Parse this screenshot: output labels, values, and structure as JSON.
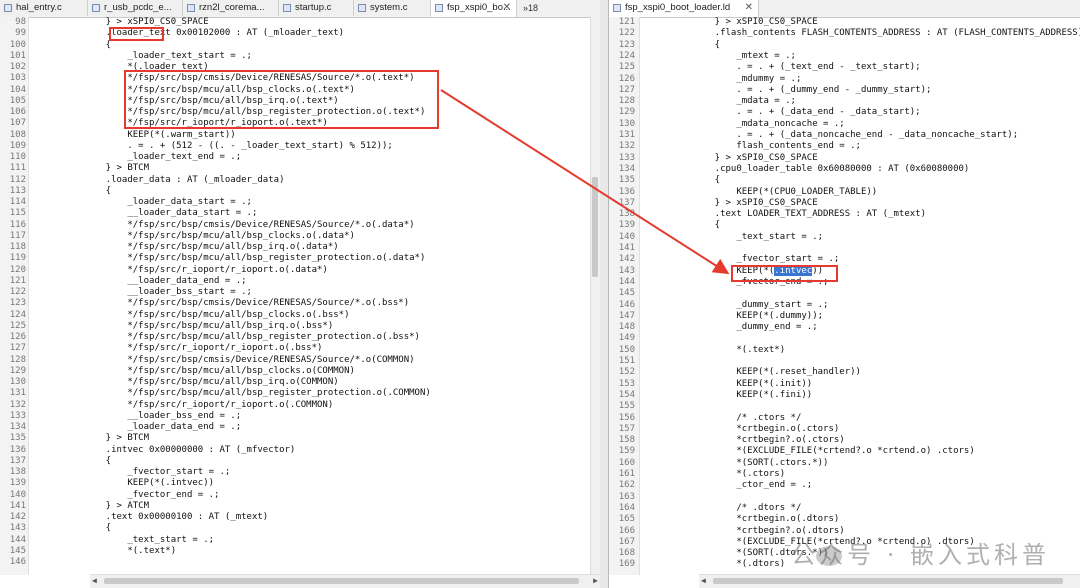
{
  "left_tabs": [
    {
      "label": "hal_entry.c",
      "active": false
    },
    {
      "label": "r_usb_pcdc_e...",
      "active": false
    },
    {
      "label": "rzn2l_corema...",
      "active": false
    },
    {
      "label": "startup.c",
      "active": false
    },
    {
      "label": "system.c",
      "active": false
    },
    {
      "label": "fsp_xspi0_bo...",
      "active": true
    }
  ],
  "left_overflow": "»18",
  "right_tab": {
    "label": "fsp_xspi0_boot_loader.ld",
    "active": true
  },
  "left_lines": [
    {
      "n": "98",
      "t": "    } > xSPI0_CS0_SPACE"
    },
    {
      "n": "99",
      "t": "    .loader_text 0x00102000 : AT (_mloader_text)"
    },
    {
      "n": "100",
      "t": "    {"
    },
    {
      "n": "101",
      "t": "        _loader_text_start = .;"
    },
    {
      "n": "102",
      "t": "        *(.loader_text)"
    },
    {
      "n": "103",
      "t": "        */fsp/src/bsp/cmsis/Device/RENESAS/Source/*.o(.text*)"
    },
    {
      "n": "104",
      "t": "        */fsp/src/bsp/mcu/all/bsp_clocks.o(.text*)"
    },
    {
      "n": "105",
      "t": "        */fsp/src/bsp/mcu/all/bsp_irq.o(.text*)"
    },
    {
      "n": "106",
      "t": "        */fsp/src/bsp/mcu/all/bsp_register_protection.o(.text*)"
    },
    {
      "n": "107",
      "t": "        */fsp/src/r_ioport/r_ioport.o(.text*)"
    },
    {
      "n": "108",
      "t": "        KEEP(*(.warm_start))"
    },
    {
      "n": "109",
      "t": "        . = . + (512 - ((. - _loader_text_start) % 512));"
    },
    {
      "n": "110",
      "t": "        _loader_text_end = .;"
    },
    {
      "n": "111",
      "t": "    } > BTCM"
    },
    {
      "n": "112",
      "t": "    .loader_data : AT (_mloader_data)"
    },
    {
      "n": "113",
      "t": "    {"
    },
    {
      "n": "114",
      "t": "        _loader_data_start = .;"
    },
    {
      "n": "115",
      "t": "        __loader_data_start = .;"
    },
    {
      "n": "116",
      "t": "        */fsp/src/bsp/cmsis/Device/RENESAS/Source/*.o(.data*)"
    },
    {
      "n": "117",
      "t": "        */fsp/src/bsp/mcu/all/bsp_clocks.o(.data*)"
    },
    {
      "n": "118",
      "t": "        */fsp/src/bsp/mcu/all/bsp_irq.o(.data*)"
    },
    {
      "n": "119",
      "t": "        */fsp/src/bsp/mcu/all/bsp_register_protection.o(.data*)"
    },
    {
      "n": "120",
      "t": "        */fsp/src/r_ioport/r_ioport.o(.data*)"
    },
    {
      "n": "121",
      "t": "        __loader_data_end = .;"
    },
    {
      "n": "122",
      "t": "        __loader_bss_start = .;"
    },
    {
      "n": "123",
      "t": "        */fsp/src/bsp/cmsis/Device/RENESAS/Source/*.o(.bss*)"
    },
    {
      "n": "124",
      "t": "        */fsp/src/bsp/mcu/all/bsp_clocks.o(.bss*)"
    },
    {
      "n": "125",
      "t": "        */fsp/src/bsp/mcu/all/bsp_irq.o(.bss*)"
    },
    {
      "n": "126",
      "t": "        */fsp/src/bsp/mcu/all/bsp_register_protection.o(.bss*)"
    },
    {
      "n": "127",
      "t": "        */fsp/src/r_ioport/r_ioport.o(.bss*)"
    },
    {
      "n": "128",
      "t": "        */fsp/src/bsp/cmsis/Device/RENESAS/Source/*.o(COMMON)"
    },
    {
      "n": "129",
      "t": "        */fsp/src/bsp/mcu/all/bsp_clocks.o(COMMON)"
    },
    {
      "n": "130",
      "t": "        */fsp/src/bsp/mcu/all/bsp_irq.o(COMMON)"
    },
    {
      "n": "131",
      "t": "        */fsp/src/bsp/mcu/all/bsp_register_protection.o(.COMMON)"
    },
    {
      "n": "132",
      "t": "        */fsp/src/r_ioport/r_ioport.o(.COMMON)"
    },
    {
      "n": "133",
      "t": "        __loader_bss_end = .;"
    },
    {
      "n": "134",
      "t": "        _loader_data_end = .;"
    },
    {
      "n": "135",
      "t": "    } > BTCM"
    },
    {
      "n": "136",
      "t": "    .intvec 0x00000000 : AT (_mfvector)"
    },
    {
      "n": "137",
      "t": "    {"
    },
    {
      "n": "138",
      "t": "        _fvector_start = .;"
    },
    {
      "n": "139",
      "t": "        KEEP(*(.intvec))"
    },
    {
      "n": "140",
      "t": "        _fvector_end = .;"
    },
    {
      "n": "141",
      "t": "    } > ATCM"
    },
    {
      "n": "142",
      "t": "    .text 0x00000100 : AT (_mtext)"
    },
    {
      "n": "143",
      "t": "    {"
    },
    {
      "n": "144",
      "t": "        _text_start = .;"
    },
    {
      "n": "145",
      "t": "        *(.text*)"
    },
    {
      "n": "146",
      "t": ""
    }
  ],
  "right_lines": [
    {
      "n": "121",
      "t": "    } > xSPI0_CS0_SPACE"
    },
    {
      "n": "122",
      "t": "    .flash_contents FLASH_CONTENTS_ADDRESS : AT (FLASH_CONTENTS_ADDRESS)"
    },
    {
      "n": "123",
      "t": "    {"
    },
    {
      "n": "124",
      "t": "        _mtext = .;"
    },
    {
      "n": "125",
      "t": "        . = . + (_text_end - _text_start);"
    },
    {
      "n": "126",
      "t": "        _mdummy = .;"
    },
    {
      "n": "127",
      "t": "        . = . + (_dummy_end - _dummy_start);"
    },
    {
      "n": "128",
      "t": "        _mdata = .;"
    },
    {
      "n": "129",
      "t": "        . = . + (_data_end - _data_start);"
    },
    {
      "n": "130",
      "t": "        _mdata_noncache = .;"
    },
    {
      "n": "131",
      "t": "        . = . + (_data_noncache_end - _data_noncache_start);"
    },
    {
      "n": "132",
      "t": "        flash_contents_end = .;"
    },
    {
      "n": "133",
      "t": "    } > xSPI0_CS0_SPACE"
    },
    {
      "n": "134",
      "t": "    .cpu0_loader_table 0x60080000 : AT (0x60080000)"
    },
    {
      "n": "135",
      "t": "    {"
    },
    {
      "n": "136",
      "t": "        KEEP(*(CPU0_LOADER_TABLE))"
    },
    {
      "n": "137",
      "t": "    } > xSPI0_CS0_SPACE"
    },
    {
      "n": "138",
      "t": "    .text LOADER_TEXT_ADDRESS : AT (_mtext)"
    },
    {
      "n": "139",
      "t": "    {"
    },
    {
      "n": "140",
      "t": "        _text_start = .;"
    },
    {
      "n": "141",
      "t": ""
    },
    {
      "n": "142",
      "t": "        _fvector_start = .;"
    },
    {
      "n": "143",
      "t": "        KEEP(*(.intvec))"
    },
    {
      "n": "144",
      "t": "        _fvector_end = .;"
    },
    {
      "n": "145",
      "t": ""
    },
    {
      "n": "146",
      "t": "        _dummy_start = .;"
    },
    {
      "n": "147",
      "t": "        KEEP(*(.dummy));"
    },
    {
      "n": "148",
      "t": "        _dummy_end = .;"
    },
    {
      "n": "149",
      "t": ""
    },
    {
      "n": "150",
      "t": "        *(.text*)"
    },
    {
      "n": "151",
      "t": ""
    },
    {
      "n": "152",
      "t": "        KEEP(*(.reset_handler))"
    },
    {
      "n": "153",
      "t": "        KEEP(*(.init))"
    },
    {
      "n": "154",
      "t": "        KEEP(*(.fini))"
    },
    {
      "n": "155",
      "t": ""
    },
    {
      "n": "156",
      "t": "        /* .ctors */"
    },
    {
      "n": "157",
      "t": "        *crtbegin.o(.ctors)"
    },
    {
      "n": "158",
      "t": "        *crtbegin?.o(.ctors)"
    },
    {
      "n": "159",
      "t": "        *(EXCLUDE_FILE(*crtend?.o *crtend.o) .ctors)"
    },
    {
      "n": "160",
      "t": "        *(SORT(.ctors.*))"
    },
    {
      "n": "161",
      "t": "        *(.ctors)"
    },
    {
      "n": "162",
      "t": "        _ctor_end = .;"
    },
    {
      "n": "163",
      "t": ""
    },
    {
      "n": "164",
      "t": "        /* .dtors */"
    },
    {
      "n": "165",
      "t": "        *crtbegin.o(.dtors)"
    },
    {
      "n": "166",
      "t": "        *crtbegin?.o(.dtors)"
    },
    {
      "n": "167",
      "t": "        *(EXCLUDE_FILE(*crtend?.o *crtend.o) .dtors)"
    },
    {
      "n": "168",
      "t": "        *(SORT(.dtors.*))"
    },
    {
      "n": "169",
      "t": "        *(.dtors)"
    }
  ],
  "highlight": {
    "left_line_index": 1,
    "left_word": ".loader_text",
    "right_line_index": 22,
    "right_word": ".intvec"
  },
  "colors": {
    "annotation": "#e53a2e",
    "selection": "#3876d0"
  },
  "watermark": "公众号 · 嵌入式科普"
}
